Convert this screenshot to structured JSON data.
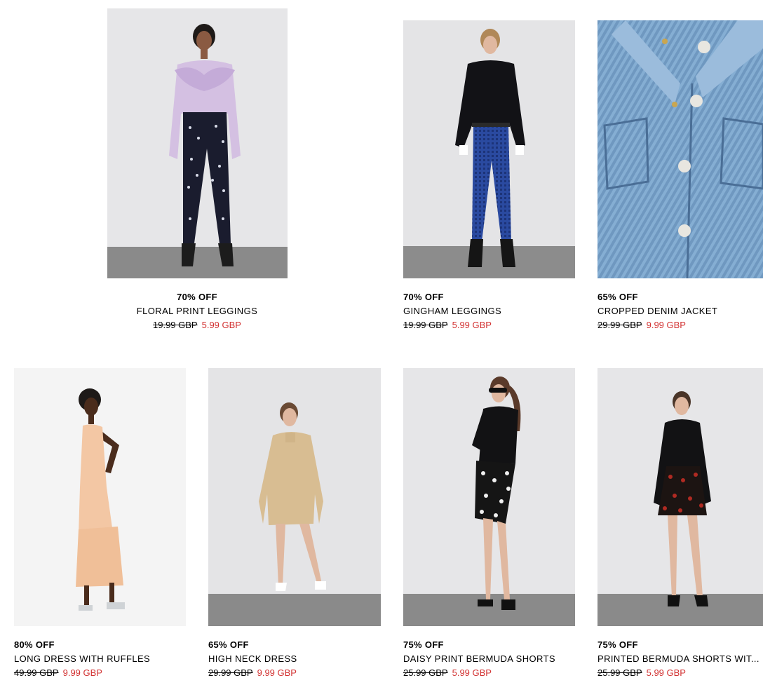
{
  "colors": {
    "sale_price": "#d23232",
    "text": "#000000",
    "photo_background": "#e9e9ea",
    "floor": "#8a8a8a"
  },
  "products": [
    {
      "discount": "70% OFF",
      "name": "FLORAL PRINT LEGGINGS",
      "old_price": "19.99 GBP",
      "new_price": "5.99 GBP",
      "image": "model-lilac-sweater-floral-leggings"
    },
    {
      "discount": "70% OFF",
      "name": "GINGHAM LEGGINGS",
      "old_price": "19.99 GBP",
      "new_price": "5.99 GBP",
      "image": "model-black-top-blue-gingham-leggings"
    },
    {
      "discount": "65% OFF",
      "name": "CROPPED DENIM JACKET",
      "old_price": "29.99 GBP",
      "new_price": "9.99 GBP",
      "image": "denim-jacket-closeup"
    },
    {
      "discount": "80% OFF",
      "name": "LONG DRESS WITH RUFFLES",
      "old_price": "49.99 GBP",
      "new_price": "9.99 GBP",
      "image": "model-peach-long-dress"
    },
    {
      "discount": "65% OFF",
      "name": "HIGH NECK DRESS",
      "old_price": "29.99 GBP",
      "new_price": "9.99 GBP",
      "image": "model-beige-shirt-dress"
    },
    {
      "discount": "75% OFF",
      "name": "DAISY PRINT BERMUDA SHORTS",
      "old_price": "25.99 GBP",
      "new_price": "5.99 GBP",
      "image": "model-black-tee-daisy-shorts"
    },
    {
      "discount": "75% OFF",
      "name": "PRINTED BERMUDA SHORTS WIT...",
      "old_price": "25.99 GBP",
      "new_price": "5.99 GBP",
      "image": "model-black-turtleneck-cherry-shorts"
    }
  ]
}
